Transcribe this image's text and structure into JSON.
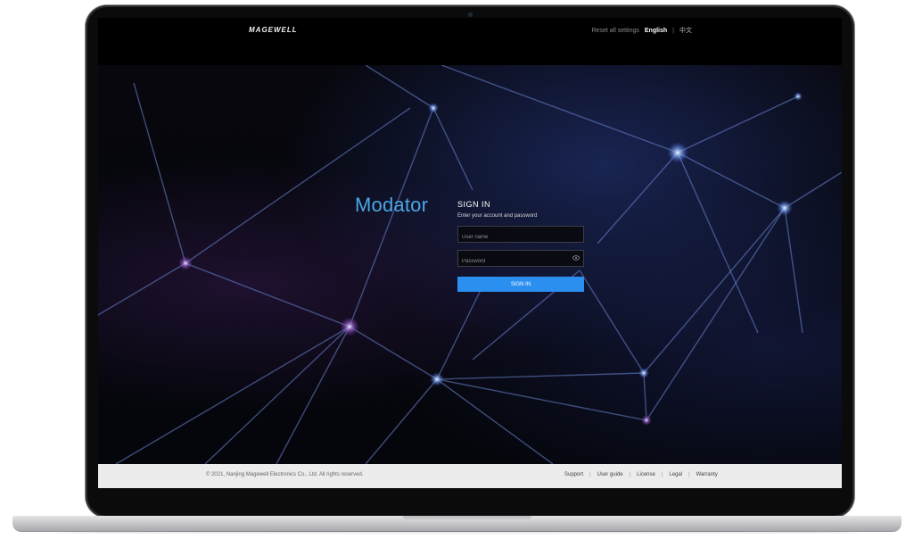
{
  "header": {
    "logo": "MAGEWELL",
    "reset_label": "Reset all settings",
    "lang_en": "English",
    "lang_sep": "|",
    "lang_zh": "中文"
  },
  "hero": {
    "product_name": "Modator"
  },
  "signin": {
    "title": "SIGN IN",
    "subtitle": "Enter your account and password",
    "username_placeholder": "User name",
    "password_placeholder": "Password",
    "button_label": "SIGN IN"
  },
  "footer": {
    "copyright": "© 2021, Nanjing Magewell Electronics Co., Ltd. All rights reserved.",
    "links": [
      "Support",
      "User guide",
      "License",
      "Legal",
      "Warranty"
    ],
    "separator": "|"
  },
  "colors": {
    "accent": "#2b8ff0",
    "product_name": "#49a7e4",
    "footer_bg": "#ececec"
  }
}
